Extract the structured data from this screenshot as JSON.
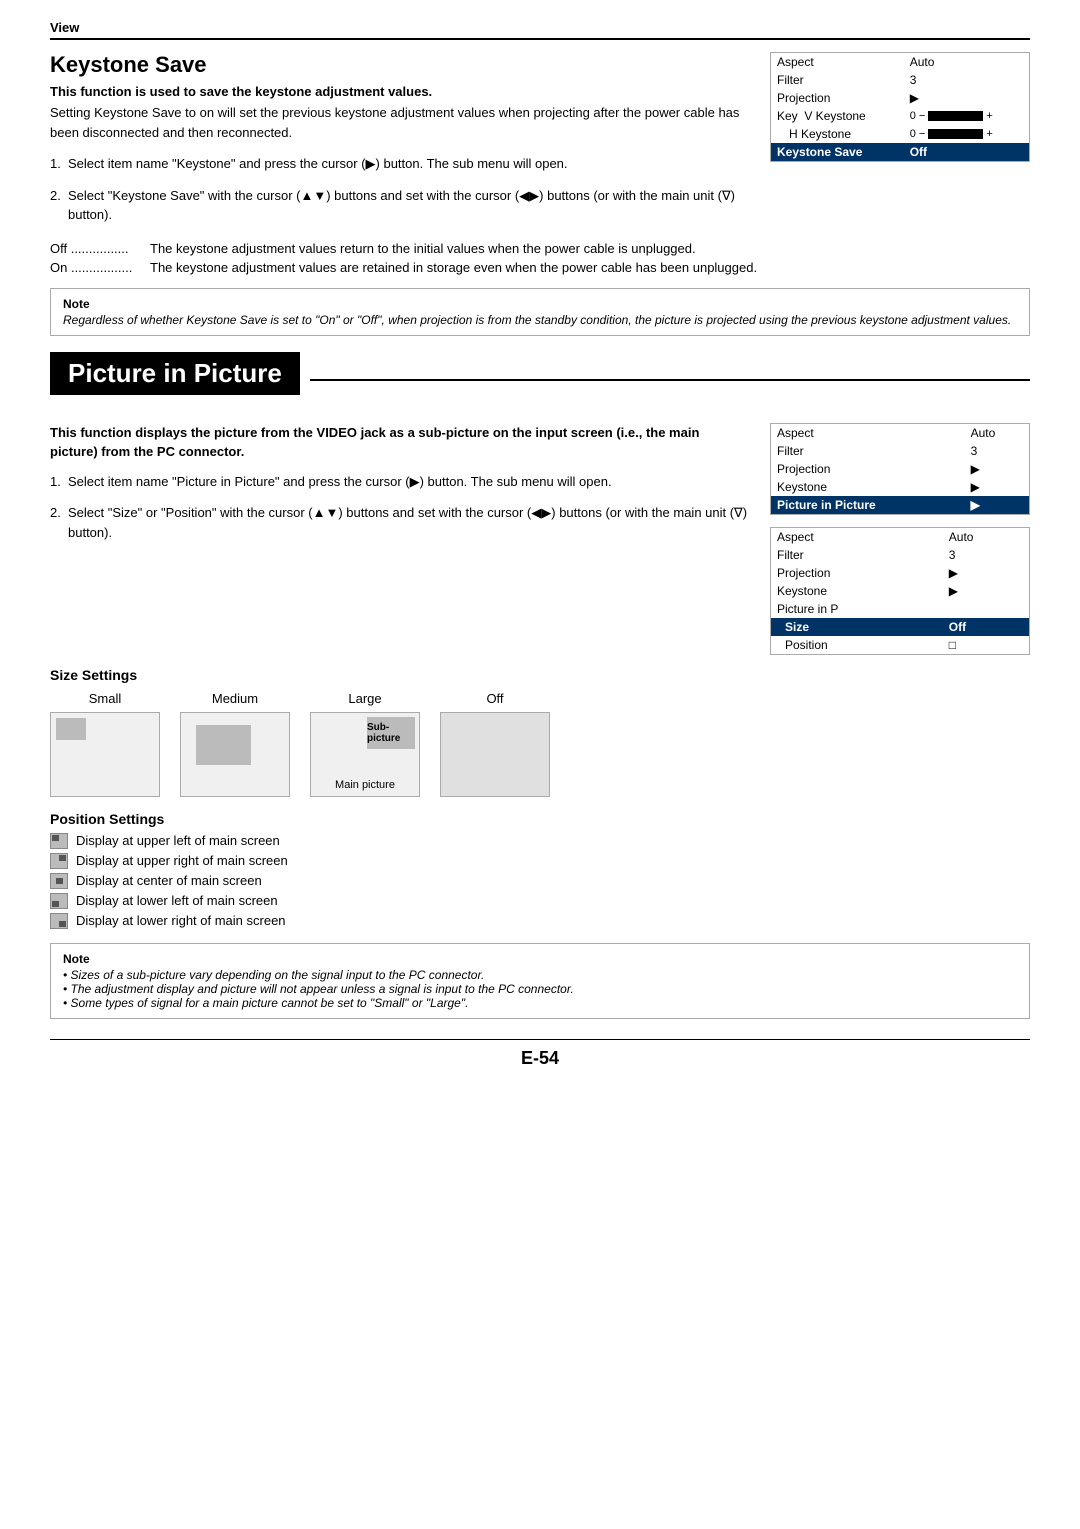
{
  "view": {
    "label": "View"
  },
  "keystone_save": {
    "title": "Keystone Save",
    "bold_para": "This function is used to save the keystone adjustment values.",
    "intro": "Setting Keystone Save to on will set the previous keystone adjustment values when projecting after the power cable has been disconnected and then reconnected.",
    "steps": [
      {
        "num": "1.",
        "text": "Select item name \"Keystone\" and press the cursor (▶) button. The sub menu will open."
      },
      {
        "num": "2.",
        "text": "Select \"Keystone Save\" with the cursor (▲▼) buttons and set with the cursor (◀▶) buttons (or with the main unit (∇) button)."
      }
    ],
    "off_label": "Off",
    "off_dots": "...............",
    "off_text": "The keystone adjustment values return to the initial values when the power cable is unplugged.",
    "on_label": "On",
    "on_dots": "...............",
    "on_text": "The keystone adjustment values are retained in storage even when the power cable has been unplugged.",
    "note_title": "Note",
    "note_text": "Regardless of whether Keystone Save is set to \"On\" or \"Off\", when projection is from the standby condition, the picture is projected using the previous keystone adjustment values.",
    "menu": {
      "rows": [
        {
          "col1": "Aspect",
          "col2": "Auto",
          "highlighted": false
        },
        {
          "col1": "Filter",
          "col2": "3",
          "highlighted": false
        },
        {
          "col1": "Projection",
          "col2": "▶",
          "highlighted": false
        },
        {
          "col1": "Key   V Keystone",
          "col2": "0  −",
          "slider": true,
          "plus": "+",
          "highlighted": false
        },
        {
          "col1": "H Keystone",
          "col2": "0  −",
          "slider": true,
          "plus": "+",
          "highlighted": false,
          "indent": true
        },
        {
          "col1": "Keystone Save",
          "col2": "Off",
          "highlighted": true
        }
      ]
    }
  },
  "pip": {
    "title": "Picture in Picture",
    "bold_intro": "This function displays the picture from the VIDEO jack as a sub-picture on the input screen (i.e., the main picture) from the PC connector.",
    "steps": [
      {
        "num": "1.",
        "text": "Select item name \"Picture in Picture\" and press the cursor (▶) button. The sub menu will open."
      },
      {
        "num": "2.",
        "text": "Select \"Size\" or \"Position\" with the cursor (▲▼) buttons and set with the cursor (◀▶) buttons (or with the main unit (∇) button)."
      }
    ],
    "menu1": {
      "rows": [
        {
          "col1": "Aspect",
          "col2": "Auto",
          "highlighted": false
        },
        {
          "col1": "Filter",
          "col2": "3",
          "highlighted": false
        },
        {
          "col1": "Projection",
          "col2": "▶",
          "highlighted": false
        },
        {
          "col1": "Keystone",
          "col2": "▶",
          "highlighted": false
        },
        {
          "col1": "Picture in Picture",
          "col2": "▶",
          "highlighted": true
        }
      ]
    },
    "menu2": {
      "rows": [
        {
          "col1": "Aspect",
          "col2": "Auto",
          "highlighted": false
        },
        {
          "col1": "Filter",
          "col2": "3",
          "highlighted": false
        },
        {
          "col1": "Projection",
          "col2": "▶",
          "highlighted": false
        },
        {
          "col1": "Keystone",
          "col2": "▶",
          "highlighted": false
        },
        {
          "col1": "Picture in P",
          "col2": "",
          "highlighted": false
        },
        {
          "col1": "Size",
          "col2": "Off",
          "highlighted": true,
          "indent": false,
          "sub": true
        },
        {
          "col1": "Position",
          "col2": "□",
          "highlighted": false,
          "sub": true
        }
      ]
    },
    "size_settings_title": "Size Settings",
    "sizes": [
      {
        "label": "Small"
      },
      {
        "label": "Medium"
      },
      {
        "label": "Large"
      },
      {
        "label": "Off"
      }
    ],
    "large_sublabel": "Sub-picture",
    "large_mainlabel": "Main picture",
    "position_settings_title": "Position Settings",
    "positions": [
      "Display at upper left of main screen",
      "Display at upper right of main screen",
      "Display at center of main screen",
      "Display at lower left of main screen",
      "Display at lower right of main screen"
    ],
    "note_title": "Note",
    "note_bullets": [
      "Sizes of a sub-picture vary depending on the signal input to the PC connector.",
      "The adjustment display and picture will not appear unless a signal is input to the PC connector.",
      "Some types of signal for a main picture cannot be set to \"Small\" or \"Large\"."
    ]
  },
  "page_number": "E-54"
}
